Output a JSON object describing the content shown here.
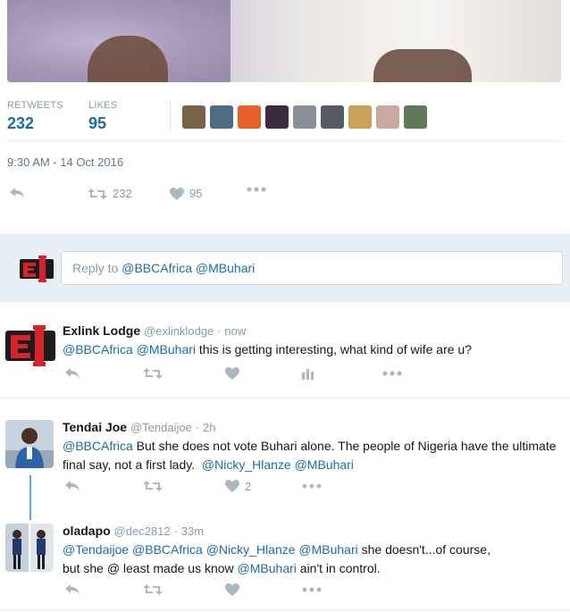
{
  "stats": {
    "retweets_label": "RETWEETS",
    "retweets_value": "232",
    "likes_label": "LIKES",
    "likes_value": "95"
  },
  "likers": [
    "#7a6248",
    "#4e6b84",
    "#e6612b",
    "#3a2a3e",
    "#8b8f96",
    "#555a63",
    "#c9a15a",
    "#c9a8a0",
    "#5f7a5a"
  ],
  "timestamp": "9:30 AM - 14 Oct 2016",
  "main_actions": {
    "retweet_count": "232",
    "like_count": "95"
  },
  "reply_box": {
    "prefix": "Reply to ",
    "mentions": "@BBCAfrica @MBuhari"
  },
  "tweets": [
    {
      "name": "Exlink Lodge",
      "handle": "@exlinklodge",
      "time": "now",
      "text_mentions": "@BBCAfrica @MBuhari",
      "text_body": " this is getting interesting, what kind of wife are u?"
    },
    {
      "name": "Tendai Joe",
      "handle": "@Tendaijoe",
      "time": "2h",
      "mention1": "@BBCAfrica",
      "text_body": " But she does not vote Buhari alone. The people of Nigeria have the ultimate final say, not a first lady.",
      "mention2": "@Nicky_Hlanze @MBuhari",
      "like_count": "2"
    },
    {
      "name": "oladapo",
      "handle": "@dec2812",
      "time": "33m",
      "mention1": "@Tendaijoe @BBCAfrica @Nicky_Hlanze @MBuhari",
      "text_body1": " she doesn't...of course,",
      "text_body2": "but she @ least made us know ",
      "mention2": "@MBuhari",
      "text_body3": " ain't in control."
    }
  ],
  "icons": {
    "reply": "reply-arrow-icon",
    "retweet": "retweet-icon",
    "like": "heart-icon",
    "more": "more-dots-icon",
    "analytics": "analytics-bars-icon"
  },
  "colors": {
    "link": "#1b6ba8",
    "muted": "#8899a6",
    "reply_bg": "#e8f0f5",
    "thread_line": "#5aa9d6",
    "brand_red": "#d8222a"
  }
}
